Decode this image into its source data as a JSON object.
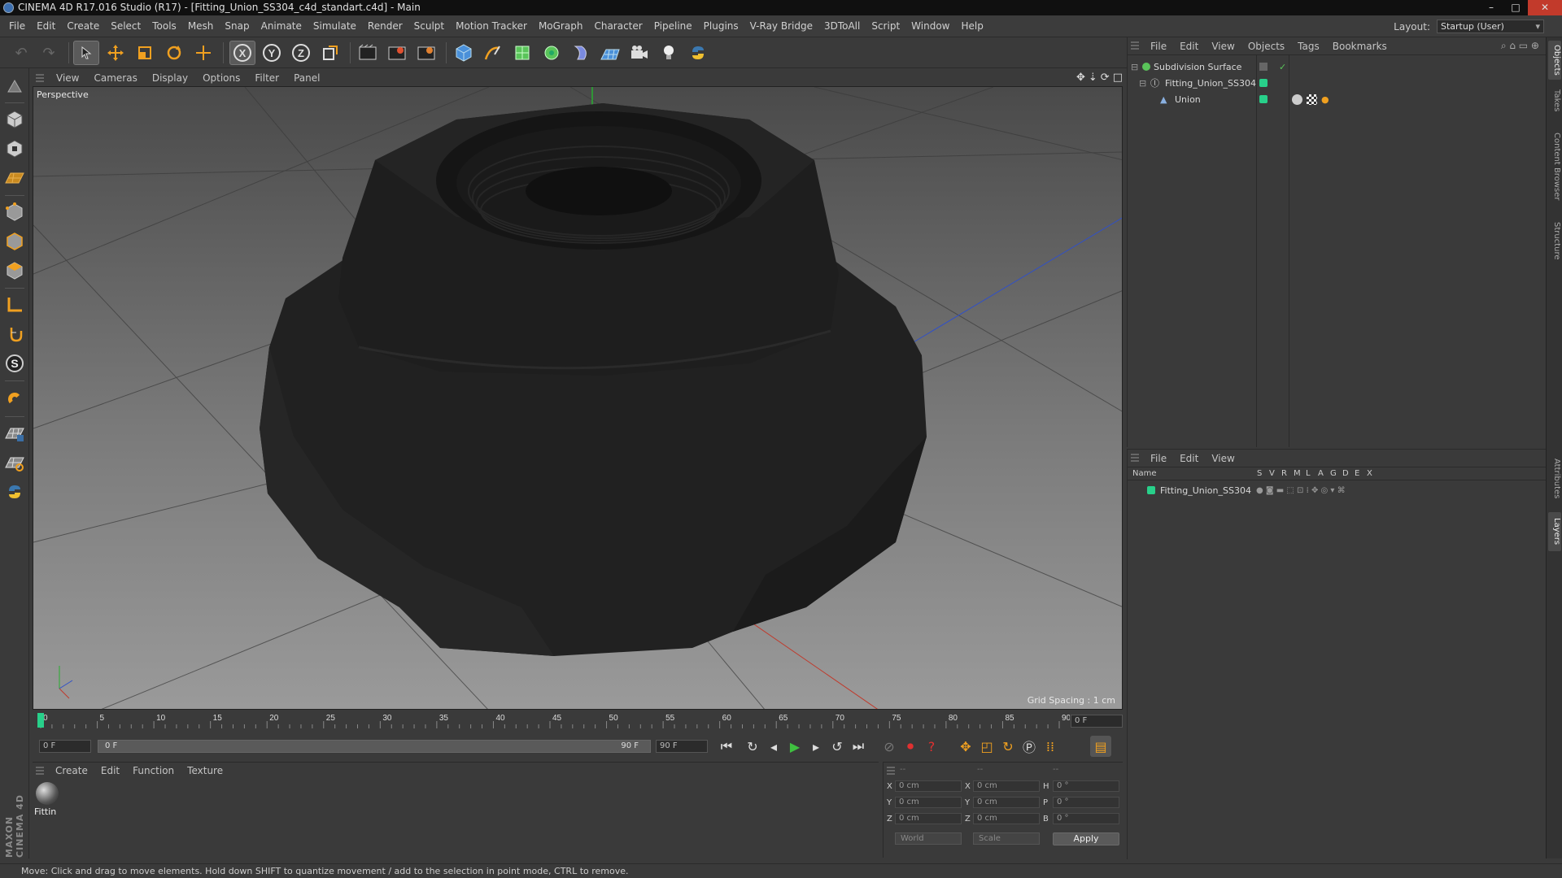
{
  "window": {
    "title": "CINEMA 4D R17.016 Studio (R17) - [Fitting_Union_SS304_c4d_standart.c4d] - Main",
    "minimize": "–",
    "maximize": "□",
    "close": "✕"
  },
  "menu": [
    "File",
    "Edit",
    "Create",
    "Select",
    "Tools",
    "Mesh",
    "Snap",
    "Animate",
    "Simulate",
    "Render",
    "Sculpt",
    "Motion Tracker",
    "MoGraph",
    "Character",
    "Pipeline",
    "Plugins",
    "V-Ray Bridge",
    "3DToAll",
    "Script",
    "Window",
    "Help"
  ],
  "layout": {
    "label": "Layout:",
    "value": "Startup (User)"
  },
  "toolbar": {
    "icons": [
      "undo-icon",
      "redo-icon",
      "select-arrow-icon",
      "move-icon",
      "scale-icon",
      "rotate-icon",
      "add-icon",
      "x-axis-icon",
      "y-axis-icon",
      "z-axis-icon",
      "coordinate-system-icon",
      "render-view-icon",
      "render-picture-viewer-icon",
      "render-settings-icon",
      "cube-icon",
      "pen-icon",
      "subdivision-icon",
      "mograph-cloner-icon",
      "deformer-icon",
      "floor-icon",
      "camera-icon",
      "light-icon",
      "python-icon"
    ],
    "axis_x": "X",
    "axis_y": "Y",
    "axis_z": "Z"
  },
  "left_toolbar": {
    "icons": [
      "make-editable-icon",
      "model-mode-icon",
      "texture-mode-icon",
      "workplane-mode-icon",
      "points-mode-icon",
      "edges-mode-icon",
      "polygons-mode-icon",
      "axis-mode-icon",
      "tweak-mode-icon",
      "solo-icon",
      "snap-icon",
      "quantize-icon",
      "lock-workplane-icon",
      "python-script-icon"
    ],
    "solo_label": "S"
  },
  "viewport": {
    "menu": [
      "View",
      "Cameras",
      "Display",
      "Options",
      "Filter",
      "Panel"
    ],
    "label": "Perspective",
    "grid_spacing": "Grid Spacing : 1 cm",
    "nav_icons": [
      "move-view-icon",
      "zoom-view-icon",
      "rotate-view-icon",
      "maximize-view-icon"
    ]
  },
  "timeline": {
    "ticks": [
      "0",
      "5",
      "10",
      "15",
      "20",
      "25",
      "30",
      "35",
      "40",
      "45",
      "50",
      "55",
      "60",
      "65",
      "70",
      "75",
      "80",
      "85",
      "90"
    ],
    "current": "0 F",
    "end_field": "0 F",
    "min_field": "0 F",
    "range_start": "0 F",
    "range_end": "90 F",
    "max_field": "90 F"
  },
  "transport": [
    "go-to-start-icon",
    "prev-key-icon",
    "prev-frame-icon",
    "play-icon",
    "next-frame-icon",
    "next-key-icon",
    "go-to-end-icon",
    "record-keys-icon",
    "auto-keyframe-icon",
    "keyframe-selection-icon",
    "position-key-icon",
    "scale-key-icon",
    "rotation-key-icon",
    "param-key-icon",
    "pla-key-icon",
    "timeline-icon"
  ],
  "materials": {
    "menu": [
      "Create",
      "Edit",
      "Function",
      "Texture"
    ],
    "items": [
      {
        "name": "Fittin"
      }
    ]
  },
  "coordinates": {
    "headers": [
      "--",
      "--",
      "--"
    ],
    "rows": [
      {
        "a": "X",
        "av": "0 cm",
        "b": "X",
        "bv": "0 cm",
        "c": "H",
        "cv": "0 °"
      },
      {
        "a": "Y",
        "av": "0 cm",
        "b": "Y",
        "bv": "0 cm",
        "c": "P",
        "cv": "0 °"
      },
      {
        "a": "Z",
        "av": "0 cm",
        "b": "Z",
        "bv": "0 cm",
        "c": "B",
        "cv": "0 °"
      }
    ],
    "mode1": "World",
    "mode2": "Scale",
    "apply": "Apply"
  },
  "object_manager": {
    "menu": [
      "File",
      "Edit",
      "View",
      "Objects",
      "Tags",
      "Bookmarks"
    ],
    "objects": [
      {
        "name": "Subdivision Surface",
        "indent": 0,
        "tag_color": "#5ac45a"
      },
      {
        "name": "Fitting_Union_SS304",
        "indent": 1,
        "tag_color": "#28d08a"
      },
      {
        "name": "Union",
        "indent": 2,
        "tag_color": "#28d08a"
      }
    ]
  },
  "layer_manager": {
    "menu": [
      "File",
      "Edit",
      "View"
    ],
    "columns": [
      "Name",
      "S",
      "V",
      "R",
      "M",
      "L",
      "A",
      "G",
      "D",
      "E",
      "X"
    ],
    "layers": [
      {
        "name": "Fitting_Union_SS304",
        "color": "#28d08a"
      }
    ]
  },
  "side_tabs": [
    "Objects",
    "Takes",
    "Content Browser",
    "Structure",
    "Attributes",
    "Layers"
  ],
  "status": "Move: Click and drag to move elements. Hold down SHIFT to quantize movement / add to the selection in point mode, CTRL to remove.",
  "brand": {
    "logo": "MAXON CINEMA 4D"
  },
  "colors": {
    "axis_x": "#c0392b",
    "axis_y": "#27ae2f",
    "axis_z": "#3050c8",
    "accent": "#28d08a"
  }
}
